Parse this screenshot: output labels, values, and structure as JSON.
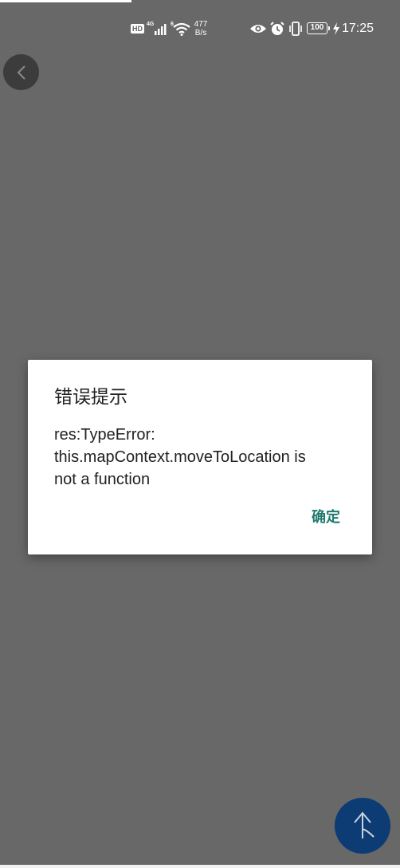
{
  "status_bar": {
    "hd_label": "HD",
    "net_label_1": "4G",
    "net_label_2": "6",
    "speed_value": "477",
    "speed_unit": "B/s",
    "battery_level": "100",
    "time": "17:25",
    "icons": [
      "hd-icon",
      "signal-icon",
      "wifi-icon",
      "eye-icon",
      "alarm-icon",
      "vibrate-icon",
      "battery-icon",
      "charging-icon"
    ]
  },
  "nav": {
    "back_icon": "chevron-left-icon"
  },
  "dialog": {
    "title": "错误提示",
    "message": "res:TypeError:\nthis.mapContext.moveToLocation is\nnot a function",
    "confirm_label": "确定"
  },
  "fab": {
    "icon": "navigation-arrow-icon"
  },
  "colors": {
    "overlay": "#686868",
    "dialog_bg": "#ffffff",
    "accent": "#1f7a6e",
    "fab_bg": "#0d3b73"
  }
}
